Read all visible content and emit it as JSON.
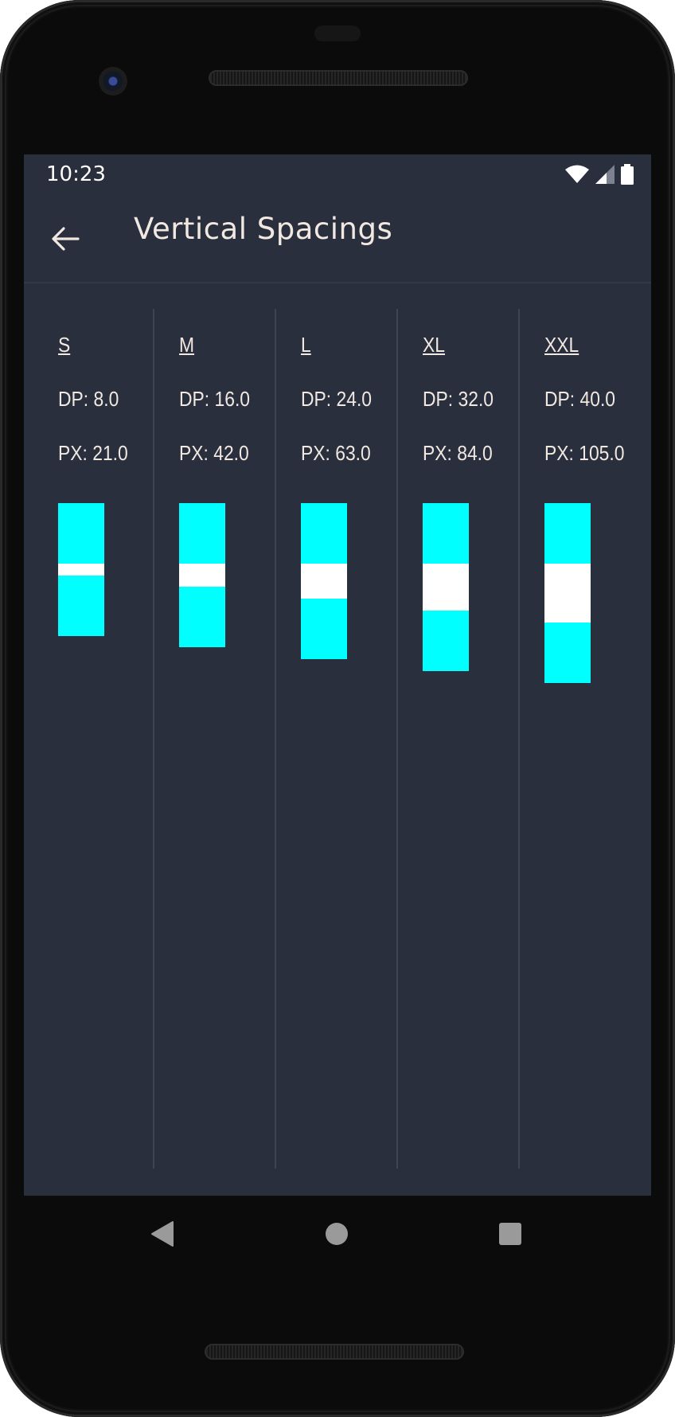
{
  "status_bar": {
    "time": "10:23",
    "icons": [
      "wifi-icon",
      "cell-signal-icon",
      "battery-icon"
    ]
  },
  "app_bar": {
    "back_icon": "arrow-left-icon",
    "title": "Vertical Spacings"
  },
  "spacings": [
    {
      "name": "S",
      "dp": "DP: 8.0",
      "px": "PX: 21.0",
      "spacing_px": 21
    },
    {
      "name": "M",
      "dp": "DP: 16.0",
      "px": "PX: 42.0",
      "spacing_px": 42
    },
    {
      "name": "L",
      "dp": "DP: 24.0",
      "px": "PX: 63.0",
      "spacing_px": 63
    },
    {
      "name": "XL",
      "dp": "DP: 32.0",
      "px": "PX: 84.0",
      "spacing_px": 84
    },
    {
      "name": "XXL",
      "dp": "DP: 40.0",
      "px": "PX: 105.0",
      "spacing_px": 105
    }
  ],
  "colors": {
    "background": "#292f3d",
    "text": "#f2e8e2",
    "swatch_block": "#00ffff",
    "swatch_gap": "#ffffff",
    "divider": "#3d4454"
  },
  "nav_bar": {
    "items": [
      "back-triangle-icon",
      "home-circle-icon",
      "recents-square-icon"
    ]
  }
}
